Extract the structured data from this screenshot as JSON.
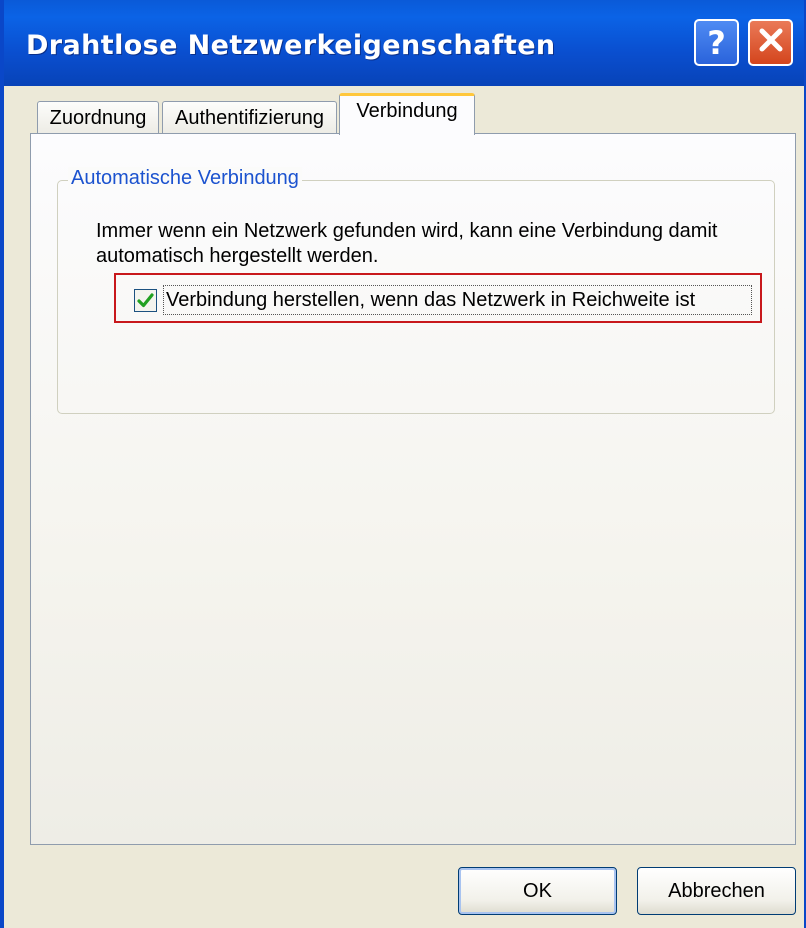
{
  "window": {
    "title": "Drahtlose Netzwerkeigenschaften",
    "help_label": "?",
    "close_label": "✕"
  },
  "tabs": [
    {
      "label": "Zuordnung",
      "active": false
    },
    {
      "label": "Authentifizierung",
      "active": false
    },
    {
      "label": "Verbindung",
      "active": true
    }
  ],
  "group": {
    "title": "Automatische Verbindung",
    "description": "Immer wenn ein Netzwerk gefunden wird, kann eine Verbindung damit automatisch hergestellt werden.",
    "checkbox_label": "Verbindung herstellen, wenn das Netzwerk in Reichweite ist",
    "checkbox_checked": true
  },
  "buttons": {
    "ok_label": "OK",
    "cancel_label": "Abbrechen"
  },
  "colors": {
    "titlebar": "#0a5ad8",
    "group_title": "#1c53cf",
    "highlight": "#c8181c",
    "check": "#21a121"
  }
}
